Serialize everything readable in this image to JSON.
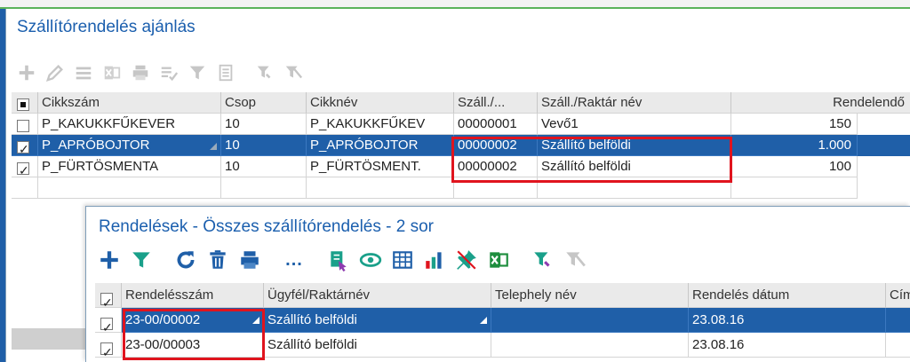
{
  "panel1": {
    "title": "Szállítórendelés ajánlás",
    "toolbar": [
      "plus-icon",
      "pencil-icon",
      "list-icon",
      "excel-icon",
      "print-icon",
      "checklist-icon",
      "filter-icon",
      "document-icon",
      "filter-edit-icon",
      "filter-clear-icon"
    ],
    "columns": [
      "",
      "Cikkszám",
      "Csop",
      "Cikknév",
      "Száll./...",
      "Száll./Raktár név",
      "Rendelendő"
    ],
    "rows": [
      {
        "checked": false,
        "cikkszam": "P_KAKUKKFŰKEVER",
        "csop": "10",
        "cikknev": "P_KAKUKKFŰKEV",
        "szall": "00000001",
        "szall_nev": "Vevő1",
        "rendelendo": "150"
      },
      {
        "checked": true,
        "cikkszam": "P_APRÓBOJTOR",
        "csop": "10",
        "cikknev": "P_APRÓBOJTOR",
        "szall": "00000002",
        "szall_nev": "Szállító belföldi",
        "rendelendo": "1.000"
      },
      {
        "checked": true,
        "cikkszam": "P_FÜRTÖSMENTA",
        "csop": "10",
        "cikknev": "P_FÜRTÖSMENT.",
        "szall": "00000002",
        "szall_nev": "Szállító belföldi",
        "rendelendo": "100"
      }
    ]
  },
  "panel2": {
    "title": "Rendelések - Összes szállítórendelés - 2 sor",
    "toolbar": [
      "plus-icon",
      "filter-icon",
      "refresh-icon",
      "trash-icon",
      "print-icon",
      "more-icon",
      "export-icon",
      "eye-icon",
      "table-icon",
      "bar-chart-icon",
      "pin-icon",
      "excel-icon",
      "filter-edit-icon",
      "filter-clear-icon"
    ],
    "more_label": "...",
    "columns": [
      "",
      "Rendelésszám",
      "Ügyfél/Raktárnév",
      "Telephely név",
      "Rendelés dátum",
      "Cím"
    ],
    "rows": [
      {
        "checked": true,
        "rendelesszam": "23-00/00002",
        "ugyfel": "Szállító belföldi",
        "telephely": "",
        "datum": "23.08.16",
        "cim": ""
      },
      {
        "checked": true,
        "rendelesszam": "23-00/00003",
        "ugyfel": "Szállító belföldi",
        "telephely": "",
        "datum": "23.08.16",
        "cim": ""
      }
    ]
  },
  "colors": {
    "accent": "#1f5fa8",
    "highlight_box": "#e0141e",
    "title": "#1b5fae"
  }
}
